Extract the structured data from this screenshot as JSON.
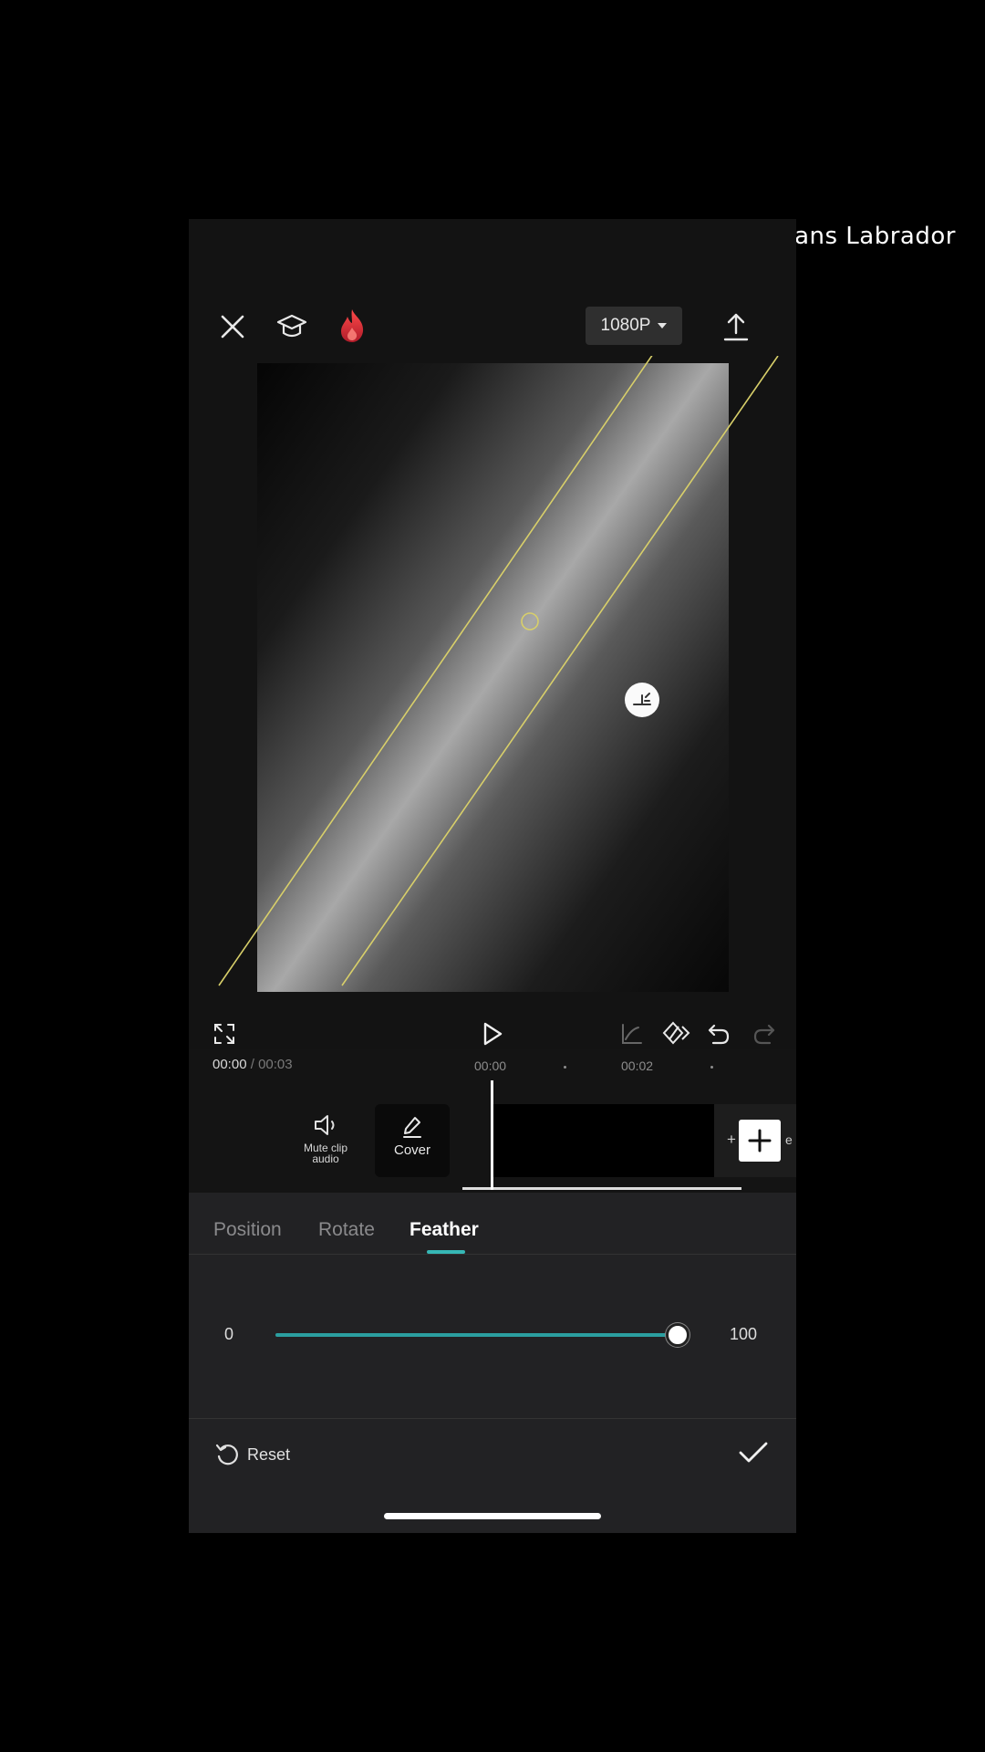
{
  "watermark": "Fans Labrador",
  "toolbar": {
    "resolution": "1080P"
  },
  "playback": {
    "current_time": "00:00",
    "separator": " / ",
    "total_time": "00:03"
  },
  "ruler": {
    "marks": [
      "00:00",
      "00:02"
    ]
  },
  "track": {
    "mute_label_line1": "Mute clip",
    "mute_label_line2": "audio",
    "cover_label": "Cover"
  },
  "tabs": [
    {
      "label": "Position"
    },
    {
      "label": "Rotate"
    },
    {
      "label": "Feather"
    }
  ],
  "active_tab": "Feather",
  "feather_slider": {
    "min_label": "0",
    "max_label": "100",
    "value_fraction": 1.0
  },
  "footer": {
    "reset_label": "Reset"
  },
  "colors": {
    "accent": "#2b9fa0",
    "mask_line": "#d8cf6a",
    "brand_flame": "#e8323c"
  }
}
